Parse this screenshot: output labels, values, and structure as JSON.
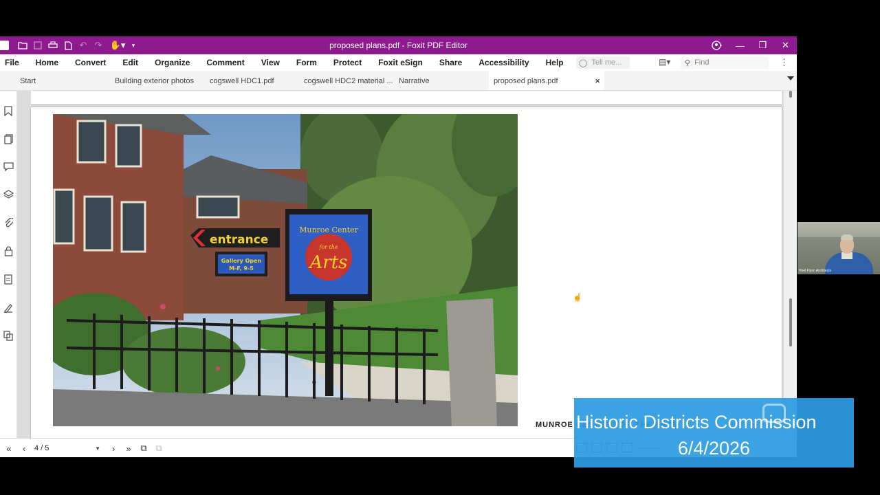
{
  "window": {
    "title": "proposed plans.pdf - Foxit PDF Editor"
  },
  "quick_access_icons": [
    "app-logo-icon",
    "open-folder-icon",
    "save-icon",
    "print-icon",
    "export-icon",
    "undo-icon",
    "redo-icon",
    "hand-tool-icon"
  ],
  "menu": {
    "items": [
      "File",
      "Home",
      "Convert",
      "Edit",
      "Organize",
      "Comment",
      "View",
      "Form",
      "Protect",
      "Foxit eSign",
      "Share",
      "Accessibility",
      "Help"
    ],
    "tell_me_placeholder": "Tell me...",
    "find_placeholder": "Find"
  },
  "tabs": [
    {
      "label": "Start"
    },
    {
      "label": "Building exterior photos"
    },
    {
      "label": "cogswell HDC1.pdf"
    },
    {
      "label": "cogswell HDC2 material ..."
    },
    {
      "label": "Narrative"
    },
    {
      "label": "proposed plans.pdf",
      "active": true,
      "close": "×"
    }
  ],
  "sidebar_icons": [
    "bookmark-icon",
    "pages-icon",
    "comment-icon",
    "layers-icon",
    "attachment-icon",
    "security-icon",
    "form-icon",
    "signature-icon",
    "compare-icon"
  ],
  "document": {
    "photo_sign": {
      "entrance": "entrance",
      "gallery_line1": "Gallery Open",
      "gallery_line2": "M-F, 9-5",
      "munroe": "Munroe Center",
      "for_the": "for the",
      "arts": "Arts"
    },
    "caption": "MUNROE CENTER FOR THE ARTS"
  },
  "statusbar": {
    "page_indicator": "4 / 5"
  },
  "webcam": {
    "label": "Hoel Flynn Architects"
  },
  "overlay": {
    "line1": "Historic Districts Commission",
    "line2": "6/4/2026"
  }
}
